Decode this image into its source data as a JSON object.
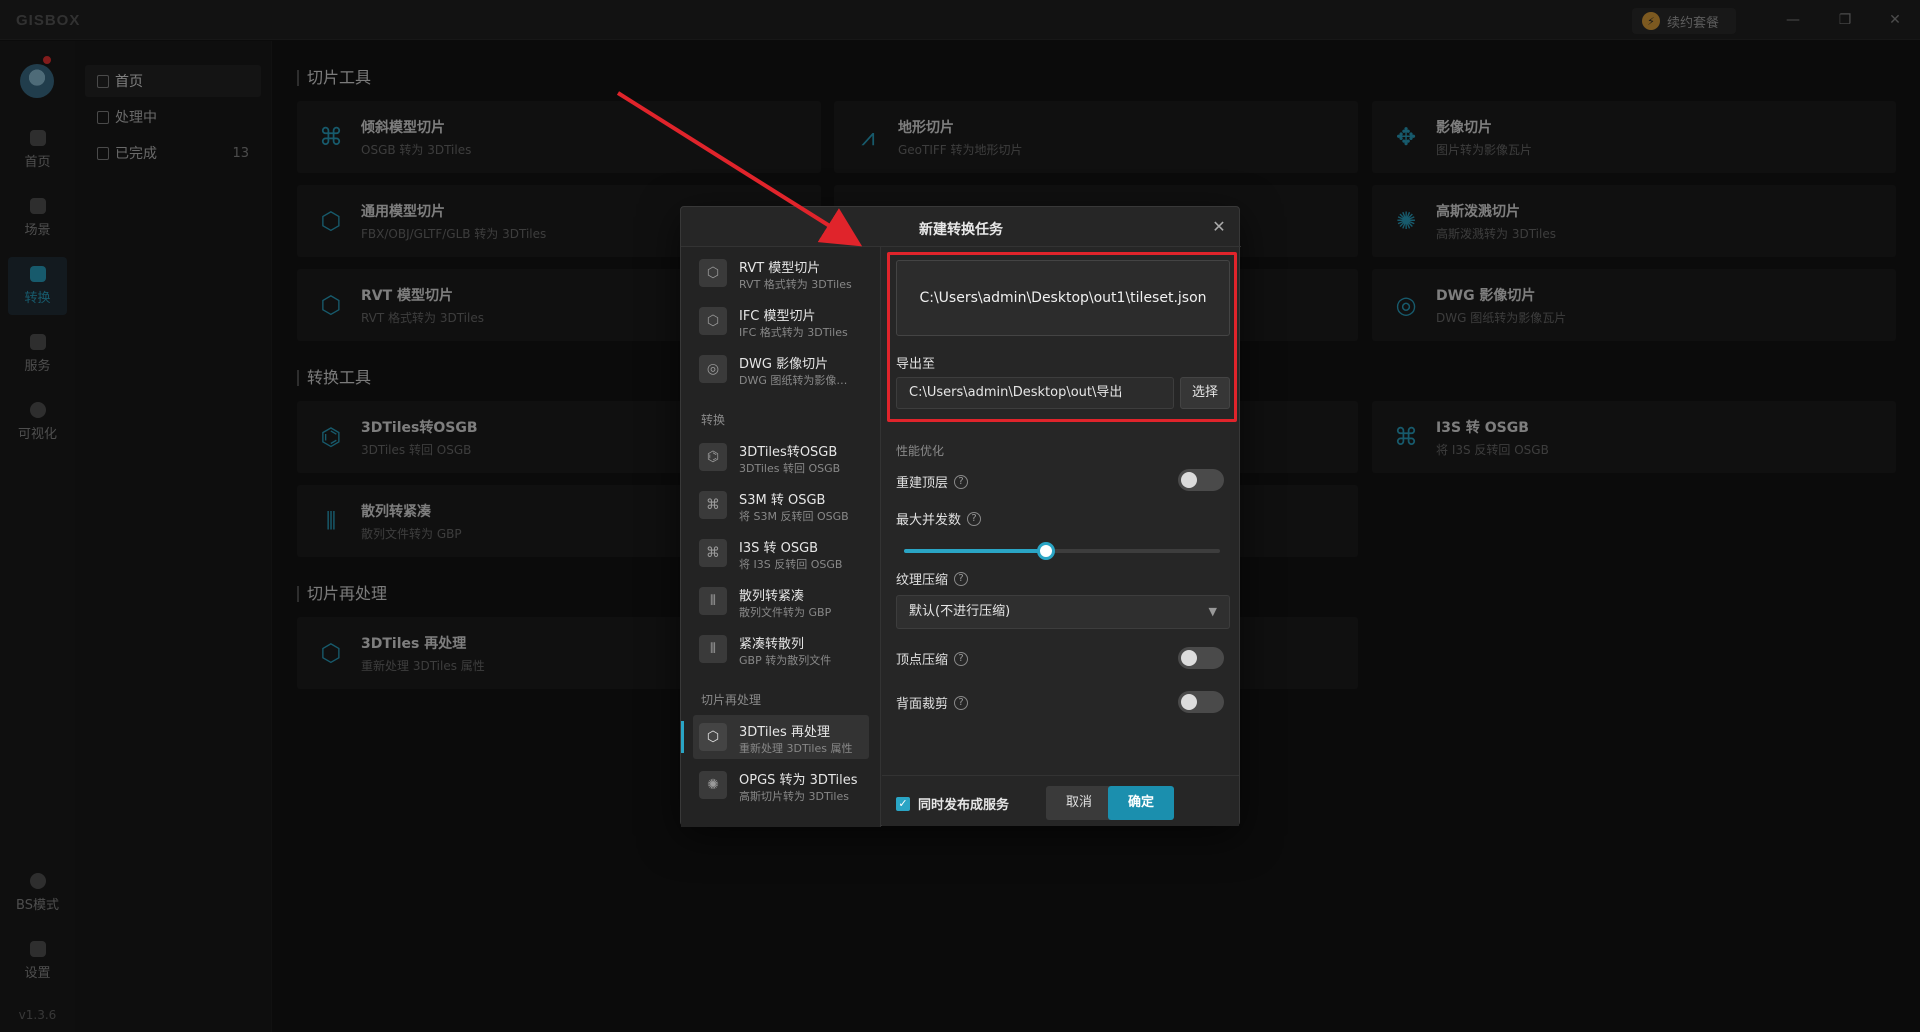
{
  "app": {
    "logo": "GISBOX",
    "renew_label": "续约套餐",
    "version": "v1.3.6"
  },
  "window_controls": {
    "minimize": "—",
    "restore": "❐",
    "close": "✕"
  },
  "rail": {
    "items": [
      {
        "label": "首页",
        "icon": "home-icon"
      },
      {
        "label": "场景",
        "icon": "scene-icon"
      },
      {
        "label": "转换",
        "icon": "convert-icon",
        "active": true
      },
      {
        "label": "服务",
        "icon": "service-icon"
      },
      {
        "label": "可视化",
        "icon": "visualize-icon"
      }
    ],
    "bottom": [
      {
        "label": "BS模式",
        "icon": "lock-icon"
      },
      {
        "label": "设置",
        "icon": "gear-icon"
      }
    ]
  },
  "subnav": {
    "items": [
      {
        "label": "首页",
        "active": true
      },
      {
        "label": "处理中"
      },
      {
        "label": "已完成",
        "count": "13"
      }
    ]
  },
  "sections": [
    {
      "title": "切片工具"
    },
    {
      "title": "转换工具"
    },
    {
      "title": "切片再处理"
    }
  ],
  "cards": {
    "tile": [
      {
        "title": "倾斜模型切片",
        "sub": "OSGB 转为 3DTiles",
        "icon": "oblique-icon"
      },
      {
        "title": "地形切片",
        "sub": "GeoTIFF 转为地形切片",
        "icon": "terrain-icon"
      },
      {
        "title": "影像切片",
        "sub": "图片转为影像瓦片",
        "icon": "image-icon"
      },
      {
        "title": "通用模型切片",
        "sub": "FBX/OBJ/GLTF/GLB 转为 3DTiles",
        "icon": "cube-icon"
      },
      {
        "title": "高斯泼溅切片",
        "sub": "高斯泼溅转为 3DTiles",
        "icon": "gaussian-icon"
      },
      {
        "title": "RVT 模型切片",
        "sub": "RVT 格式转为 3DTiles",
        "icon": "cube-icon"
      },
      {
        "title": "DWG 影像切片",
        "sub": "DWG 图纸转为影像瓦片",
        "icon": "dwg-icon"
      }
    ],
    "convert": [
      {
        "title": "3DTiles转OSGB",
        "sub": "3DTiles 转回 OSGB",
        "icon": "tiles-icon"
      },
      {
        "title": "I3S 转 OSGB",
        "sub": "将 I3S 反转回 OSGB",
        "icon": "i3s-icon"
      },
      {
        "title": "散列转紧凑",
        "sub": "散列文件转为 GBP",
        "icon": "bars-icon"
      }
    ],
    "reprocess": [
      {
        "title": "3DTiles 再处理",
        "sub": "重新处理 3DTiles 属性",
        "icon": "cube-icon"
      }
    ]
  },
  "dialog": {
    "title": "新建转换任务",
    "left_items_top": [
      {
        "title": "RVT 模型切片",
        "sub": "RVT 格式转为 3DTiles"
      },
      {
        "title": "IFC 模型切片",
        "sub": "IFC 格式转为 3DTiles"
      },
      {
        "title": "DWG 影像切片",
        "sub": "DWG 图纸转为影像…"
      }
    ],
    "group_convert": "转换",
    "left_items_convert": [
      {
        "title": "3DTiles转OSGB",
        "sub": "3DTiles 转回 OSGB"
      },
      {
        "title": "S3M 转 OSGB",
        "sub": "将 S3M 反转回 OSGB"
      },
      {
        "title": "I3S 转 OSGB",
        "sub": "将 I3S 反转回 OSGB"
      },
      {
        "title": "散列转紧凑",
        "sub": "散列文件转为 GBP"
      },
      {
        "title": "紧凑转散列",
        "sub": "GBP 转为散列文件"
      }
    ],
    "group_reprocess": "切片再处理",
    "left_items_reprocess": [
      {
        "title": "3DTiles 再处理",
        "sub": "重新处理 3DTiles 属性",
        "active": true
      },
      {
        "title": "OPGS 转为 3DTiles",
        "sub": "高斯切片转为 3DTiles"
      }
    ],
    "input_path": "C:\\Users\\admin\\Desktop\\out1\\tileset.json",
    "export_label": "导出至",
    "export_path": "C:\\Users\\admin\\Desktop\\out\\导出",
    "select_label": "选择",
    "perf_group": "性能优化",
    "rebuild_top_label": "重建顶层",
    "max_concurrency_label": "最大并发数",
    "max_concurrency_fraction": 0.45,
    "texture_compress_label": "纹理压缩",
    "texture_compress_value": "默认(不进行压缩)",
    "vertex_compress_label": "顶点压缩",
    "backface_cull_label": "背面裁剪",
    "publish_label": "同时发布成服务",
    "cancel_label": "取消",
    "ok_label": "确定"
  },
  "colors": {
    "accent": "#2aa5c5",
    "highlight": "#e0242b"
  }
}
